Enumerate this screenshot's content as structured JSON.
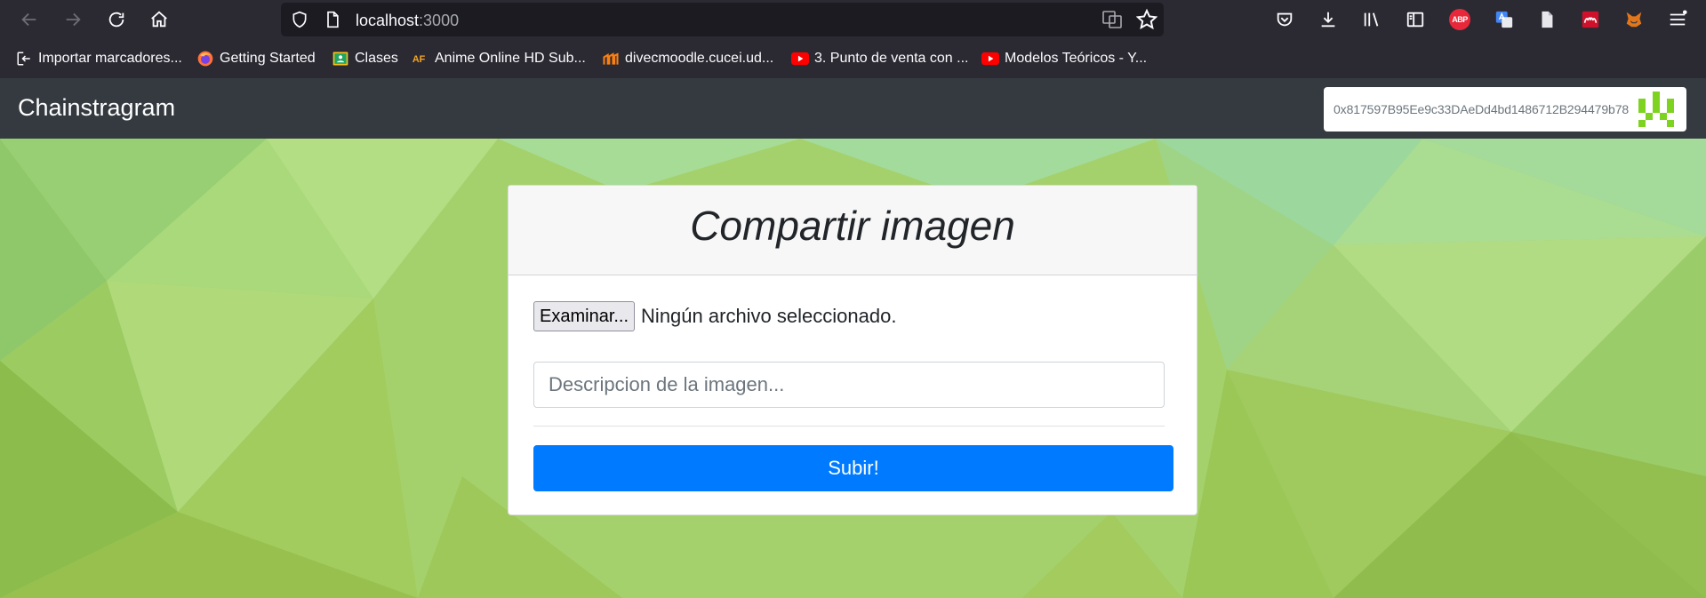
{
  "browser": {
    "url_host": "localhost",
    "url_port": ":3000",
    "bookmarks": [
      {
        "label": "Importar marcadores..."
      },
      {
        "label": "Getting Started"
      },
      {
        "label": "Clases"
      },
      {
        "label": "Anime Online HD Sub..."
      },
      {
        "label": "divecmoodle.cucei.ud..."
      },
      {
        "label": "3. Punto de venta con ..."
      },
      {
        "label": "Modelos Teóricos - Y..."
      }
    ],
    "abp_label": "ABP"
  },
  "app": {
    "brand": "Chainstragram",
    "account_address": "0x817597B95Ee9c33DAeDd4bd1486712B294479b78"
  },
  "form": {
    "title": "Compartir imagen",
    "file_button_label": "Examinar...",
    "file_status": "Ningún archivo seleccionado.",
    "description_placeholder": "Descripcion de la imagen...",
    "submit_label": "Subir!"
  },
  "colors": {
    "navbar": "#343a40",
    "primary": "#007bff",
    "background_green": "#a7d46f"
  }
}
